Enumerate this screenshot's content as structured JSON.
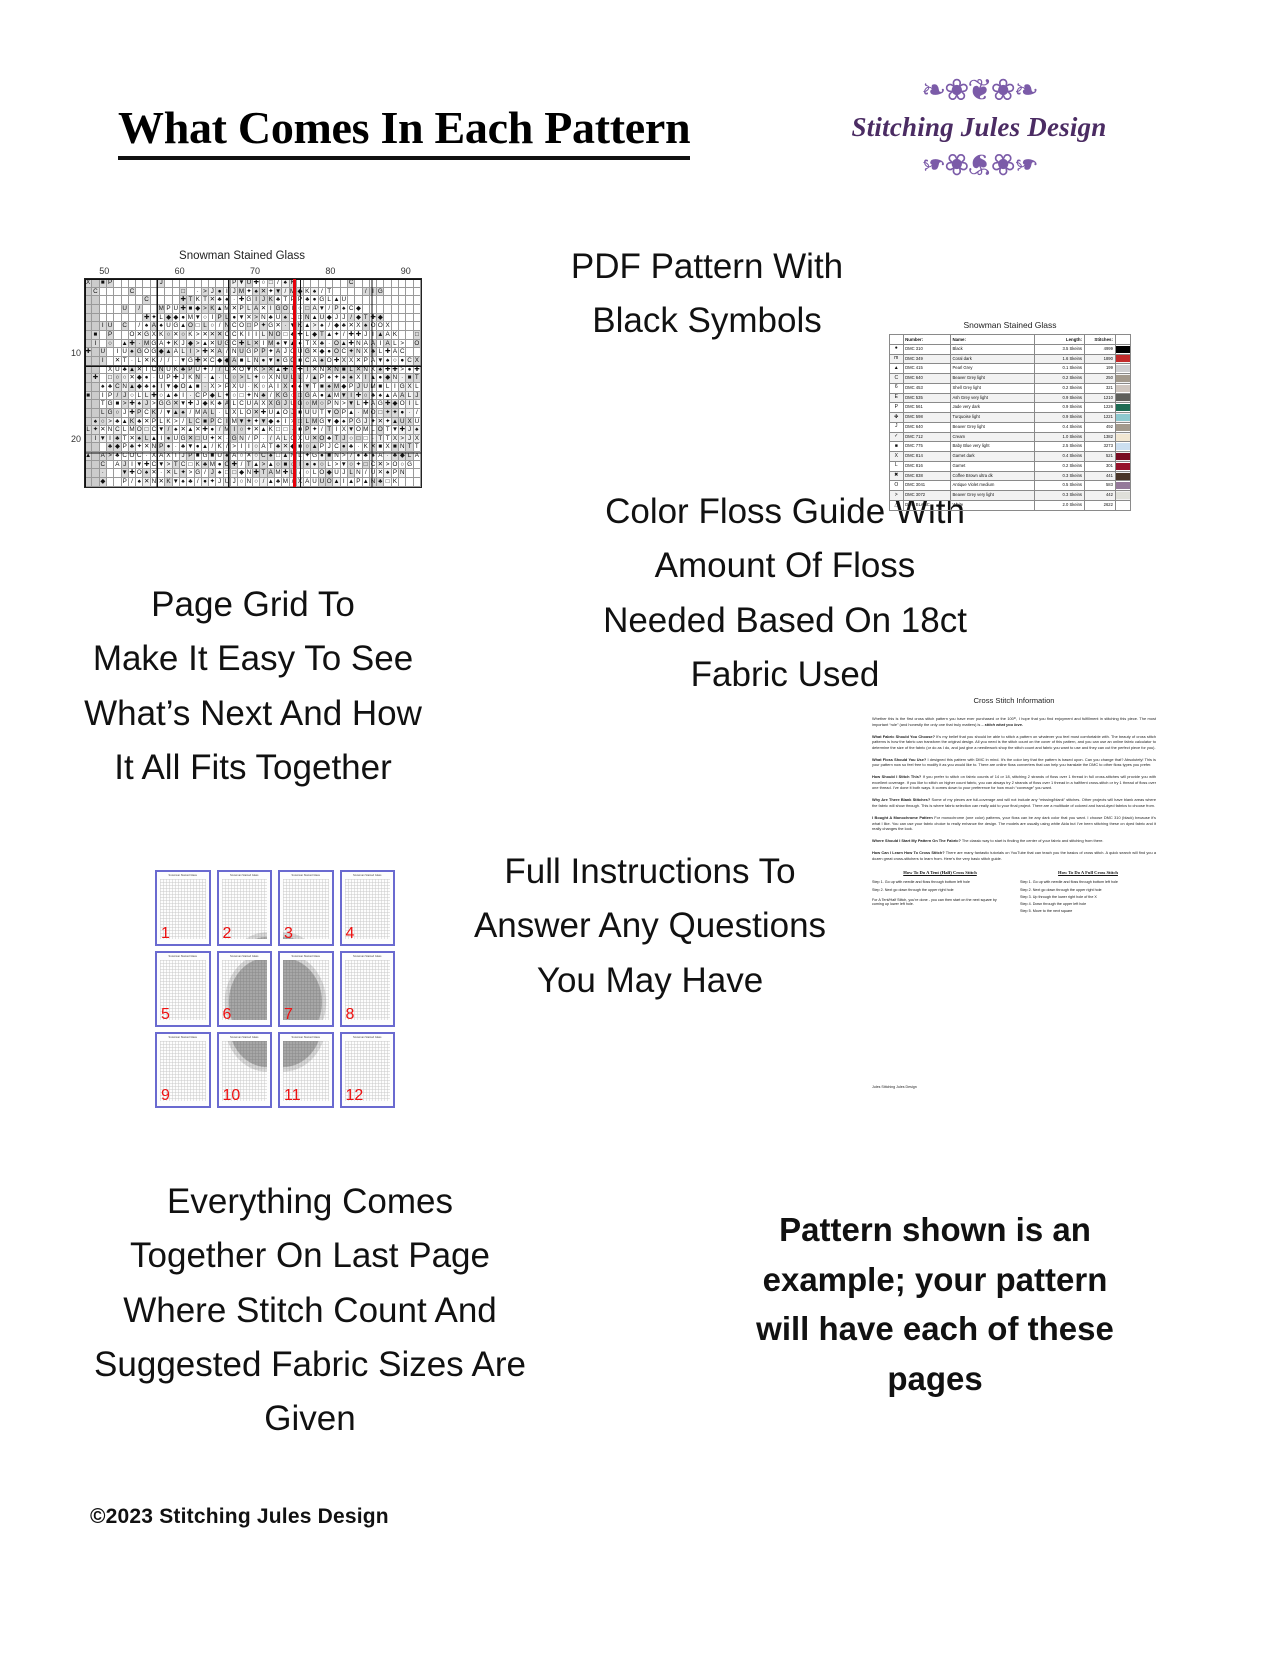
{
  "header": {
    "title": "What Comes In Each Pattern",
    "logo": {
      "brand": "Stitching Jules Design",
      "flourish_top": "❧❀❦❀❧",
      "flourish_bottom": "❧❀❦❀❧"
    }
  },
  "copy": {
    "pdf_pattern": "PDF Pattern With\nBlack Symbols",
    "page_grid": "Page Grid To\nMake It Easy To See\nWhat’s Next And How\nIt All Fits Together",
    "floss_guide": "Color Floss Guide With\nAmount Of Floss\nNeeded Based On 18ct\nFabric Used",
    "instructions": "Full Instructions To\nAnswer Any Questions\nYou May Have",
    "last_page": "Everything Comes\nTogether On Last Page\nWhere Stitch Count And\nSuggested Fabric Sizes Are\nGiven",
    "example_note": "Pattern shown is an example; your pattern will have each of these pages"
  },
  "copyright": "©2023 Stitching Jules Design",
  "chart": {
    "title": "Snowman Stained Glass",
    "column_labels": [
      "50",
      "60",
      "70",
      "80",
      "90"
    ],
    "row_labels": [
      "10",
      "20"
    ],
    "center_line_color": "#e8000a",
    "symbols": "●○■□✕✦✚▲▼◆♠♣ICJLKPTXMAGNOU>/·",
    "grid_cols": 46,
    "grid_rows": 24
  },
  "floss": {
    "title": "Snowman Stained Glass",
    "columns": [
      "",
      "Number:",
      "Name:",
      "Length:",
      "Stitches:",
      ""
    ],
    "rows": [
      {
        "symbol": "●",
        "number": "DMC   310",
        "name": "Black",
        "length": "3.5 Skeins",
        "stitches": "4999",
        "color": "#000000"
      },
      {
        "symbol": "m",
        "number": "DMC   349",
        "name": "Coral dark",
        "length": "1.6 Skeins",
        "stitches": "1890",
        "color": "#c32b2b"
      },
      {
        "symbol": "▲",
        "number": "DMC   415",
        "name": "Pearl Grey",
        "length": "0.1 Skeins",
        "stitches": "199",
        "color": "#cfd0d2"
      },
      {
        "symbol": "C",
        "number": "DMC   640",
        "name": "Beaver Grey light",
        "length": "0.2 Skeins",
        "stitches": "250",
        "color": "#a39a8d"
      },
      {
        "symbol": "6",
        "number": "DMC   453",
        "name": "Shell Grey light",
        "length": "0.2 Skeins",
        "stitches": "321",
        "color": "#cfc6bf"
      },
      {
        "symbol": "E",
        "number": "DMC   535",
        "name": "Ash Grey very light",
        "length": "0.9 Skeins",
        "stitches": "1210",
        "color": "#5e5f5b"
      },
      {
        "symbol": "P",
        "number": "DMC   561",
        "name": "Jade very dark",
        "length": "0.9 Skeins",
        "stitches": "1226",
        "color": "#1d6b53"
      },
      {
        "symbol": "✤",
        "number": "DMC   598",
        "name": "Turquoise light",
        "length": "0.9 Skeins",
        "stitches": "1221",
        "color": "#8ec9cf"
      },
      {
        "symbol": "J",
        "number": "DMC   640",
        "name": "Beaver Grey light",
        "length": "0.4 Skeins",
        "stitches": "492",
        "color": "#a39a8d"
      },
      {
        "symbol": "✓",
        "number": "DMC   712",
        "name": "Cream",
        "length": "1.0 Skeins",
        "stitches": "1382",
        "color": "#f2e7d2"
      },
      {
        "symbol": "■",
        "number": "DMC   775",
        "name": "Baby Blue very light",
        "length": "2.5 Skeins",
        "stitches": "3273",
        "color": "#ccdff0"
      },
      {
        "symbol": "X",
        "number": "DMC   814",
        "name": "Garnet dark",
        "length": "0.4 Skeins",
        "stitches": "521",
        "color": "#7a0c22"
      },
      {
        "symbol": "L",
        "number": "DMC   816",
        "name": "Garnet",
        "length": "0.2 Skeins",
        "stitches": "301",
        "color": "#96132b"
      },
      {
        "symbol": "✖",
        "number": "DMC   838",
        "name": "Coffee Brown ultra dk",
        "length": "0.3 Skeins",
        "stitches": "441",
        "color": "#493528"
      },
      {
        "symbol": "O",
        "number": "DMC   3041",
        "name": "Antique Violet medium",
        "length": "0.5 Skeins",
        "stitches": "583",
        "color": "#95799a"
      },
      {
        "symbol": ">",
        "number": "DMC   3072",
        "name": "Beaver Grey very light",
        "length": "0.3 Skeins",
        "stitches": "442",
        "color": "#dfe0da"
      },
      {
        "symbol": "△",
        "number": "DMC   BLANC",
        "name": "White",
        "length": "2.0 Skeins",
        "stitches": "2622",
        "color": "#ffffff"
      }
    ]
  },
  "pagegrid": {
    "mini_title": "Snowman Stained Glass",
    "pages": [
      "1",
      "2",
      "3",
      "4",
      "5",
      "6",
      "7",
      "8",
      "9",
      "10",
      "11",
      "12"
    ],
    "border_color": "#6a6ad0",
    "number_color": "#ee1111"
  },
  "instructions": {
    "doc_title": "Cross Stitch Information",
    "paragraphs": [
      {
        "lead": "",
        "text": "Whether this is the first cross stitch pattern you have ever purchased or the 100ᵗʰ, I hope that you find enjoyment and fulfillment in stitching this piece. The most important “rule” (and honestly the only one that truly matters) is – ",
        "emph": "stitch what you love."
      },
      {
        "lead": "What Fabric Should You Choose?",
        "text": " It’s my belief that you should be able to stitch a pattern on whatever you feel most comfortable with. The beauty of cross stitch patterns is how the fabric can transform the original design. All you need is the stitch count on the cover of this pattern, and you can use an online fabric calculator to determine the size of the fabric (or do as I do, and just give a needlework shop the stitch count and fabric you want to use and they can cut the perfect piece for you).",
        "emph": ""
      },
      {
        "lead": "What Floss Should You Use?",
        "text": " I designed this pattern with DMC in mind. It’s the color key that the pattern is based upon. Can you change that? Absolutely! This is your pattern now so feel free to modify it as you would like to. There are online floss converters that can help you translate the DMC to other floss types you prefer.",
        "emph": ""
      },
      {
        "lead": "How Should I Stitch This?",
        "text": " If you prefer to stitch on fabric counts of 14 or 18, stitching 2 strands of floss over 1 thread in full cross-stitches will provide you with excellent coverage. If you like to stitch on higher count fabric, you can always try 2 strands of floss over 1 thread in a half/tent cross-stitch or try 1 thread of floss over one thread. I’ve done it both ways. It comes down to your preference for how much “coverage” you want.",
        "emph": ""
      },
      {
        "lead": "Why Are There Blank Stitches?",
        "text": " Some of my pieces are full-coverage and will not include any “missing/blank” stitches. Other projects will have blank areas where the fabric will show through. This is where fabric selection can really add to your final project. There are a multitude of colored and hand-dyed fabrics to choose from.",
        "emph": ""
      },
      {
        "lead": "I Bought A Monochrome Pattern",
        "text": " For monochrome (one color) patterns, your floss can be any dark color that you want. I choose DMC 310 (black) because it’s what I like. You can use your fabric choice to really enhance the design. The models are usually using white Aida but I’ve been stitching these on dyed fabric and it really changes the look.",
        "emph": ""
      },
      {
        "lead": "Where Should I Start My Pattern On The Fabric?",
        "text": " The classic way to start is finding the center of your fabric and stitching from there.",
        "emph": ""
      },
      {
        "lead": "How Can I Learn How To Cross Stitch?",
        "text": " There are many fantastic tutorials on YouTube that can teach you the basics of cross stitch. A quick search will find you a dozen great cross-stitchers to learn from. Here’s the very basic stitch guide.",
        "emph": ""
      }
    ],
    "guides": [
      {
        "heading": "How To Do A Tent (Half) Cross Stitch",
        "steps": [
          "Step 1. Go up with needle and floss through bottom left hole",
          "Step 2. Next go down through the upper right hole"
        ],
        "note": "For A Tent/Half Stitch, you’re done - you can then start on the next square by coming up lower left hole."
      },
      {
        "heading": "How To Do A Full Cross Stitch",
        "steps": [
          "Step 1. Go up with needle and floss through bottom left hole",
          "Step 2. Next go down through the upper right hole",
          "Step 3. Up through the lower right hole of the X",
          "Step 4. Down through the upper left hole",
          "Step 5. Move to the next square"
        ],
        "note": ""
      }
    ],
    "signature": "Jules\nStitching Jules Design"
  }
}
